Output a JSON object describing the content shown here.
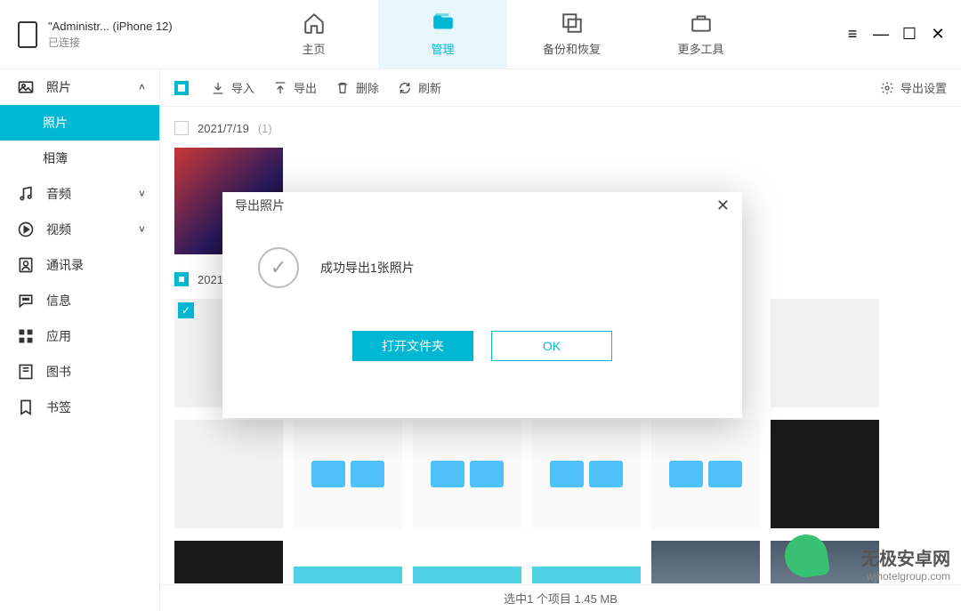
{
  "device": {
    "name": "\"Administr... (iPhone 12)",
    "status": "已连接"
  },
  "nav": {
    "home": "主页",
    "manage": "管理",
    "backup": "备份和恢复",
    "tools": "更多工具"
  },
  "sidebar": {
    "photos": "照片",
    "photos_sub": "照片",
    "albums": "相簿",
    "audio": "音频",
    "video": "视频",
    "contacts": "通讯录",
    "messages": "信息",
    "apps": "应用",
    "books": "图书",
    "bookmarks": "书签"
  },
  "toolbar": {
    "import": "导入",
    "export": "导出",
    "delete": "删除",
    "refresh": "刷新",
    "export_settings": "导出设置"
  },
  "dates": {
    "d1": "2021/7/19",
    "d1_count": "(1)",
    "d2": "2021"
  },
  "modal": {
    "title": "导出照片",
    "message": "成功导出1张照片",
    "open_folder": "打开文件夹",
    "ok": "OK"
  },
  "status": "选中1 个项目 1.45 MB",
  "watermark": {
    "line1": "无极安卓网",
    "line2": "wjhotelgroup.com"
  }
}
